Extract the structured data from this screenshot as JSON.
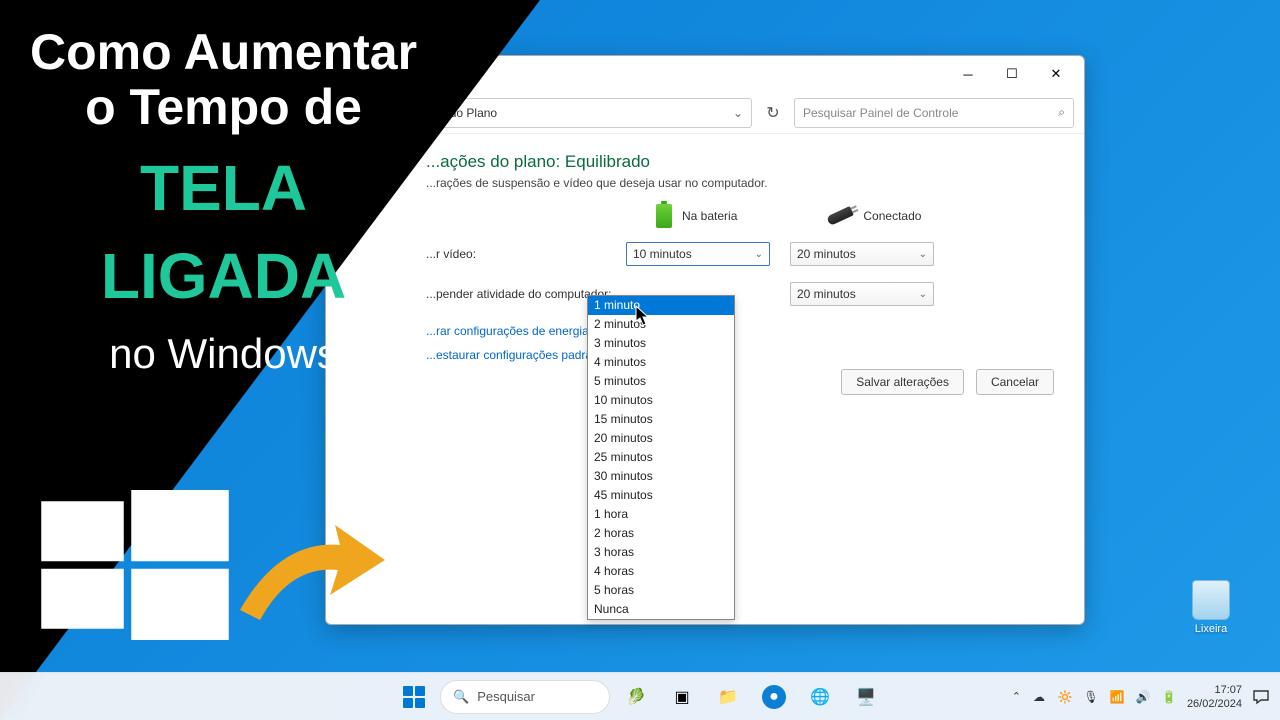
{
  "promo": {
    "line1": "Como Aumentar",
    "line2": "o Tempo de",
    "highlight1": "TELA",
    "highlight2": "LIGADA",
    "suffix": "no Windows"
  },
  "window": {
    "breadcrumb": "...ar Configurações do Plano",
    "search_placeholder": "Pesquisar Painel de Controle",
    "page_title": "...ações do plano: Equilibrado",
    "page_sub": "...rações de suspensão e vídeo que deseja usar no computador.",
    "col_battery": "Na bateria",
    "col_plugged": "Conectado",
    "row_video": "...r vídeo:",
    "row_suspend": "...pender atividade do computador:",
    "video_battery": "10 minutos",
    "video_plugged": "20 minutos",
    "suspend_plugged": "20 minutos",
    "link_advanced": "...rar configurações de energia avançadas",
    "link_restore": "...estaurar configurações padrão deste plano",
    "btn_save": "Salvar alterações",
    "btn_cancel": "Cancelar"
  },
  "dropdown": {
    "options": [
      "1 minuto",
      "2 minutos",
      "3 minutos",
      "4 minutos",
      "5 minutos",
      "10 minutos",
      "15 minutos",
      "20 minutos",
      "25 minutos",
      "30 minutos",
      "45 minutos",
      "1 hora",
      "2 horas",
      "3 horas",
      "4 horas",
      "5 horas",
      "Nunca"
    ],
    "selected": "1 minuto"
  },
  "desktop": {
    "recycle": "Lixeira"
  },
  "taskbar": {
    "search": "Pesquisar",
    "time": "17:07",
    "date": "26/02/2024"
  }
}
